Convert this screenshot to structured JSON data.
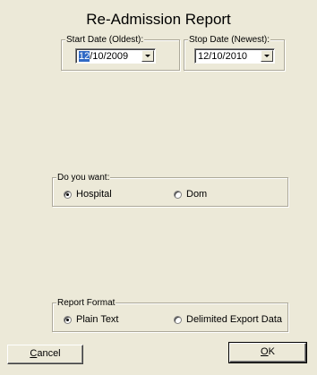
{
  "title": "Re-Admission Report",
  "start_date": {
    "legend": "Start Date (Oldest):",
    "value_highlight": "12",
    "value_rest": "/10/2009"
  },
  "stop_date": {
    "legend": "Stop Date (Newest):",
    "value": "12/10/2010"
  },
  "do_you_want": {
    "legend": "Do you want:",
    "options": [
      "Hospital",
      "Dom"
    ],
    "selected": "Hospital"
  },
  "report_format": {
    "legend": "Report Format",
    "options": [
      "Plain Text",
      "Delimited Export Data"
    ],
    "selected": "Plain Text"
  },
  "buttons": {
    "cancel_underline": "C",
    "cancel_rest": "ancel",
    "ok_underline": "O",
    "ok_rest": "K"
  }
}
